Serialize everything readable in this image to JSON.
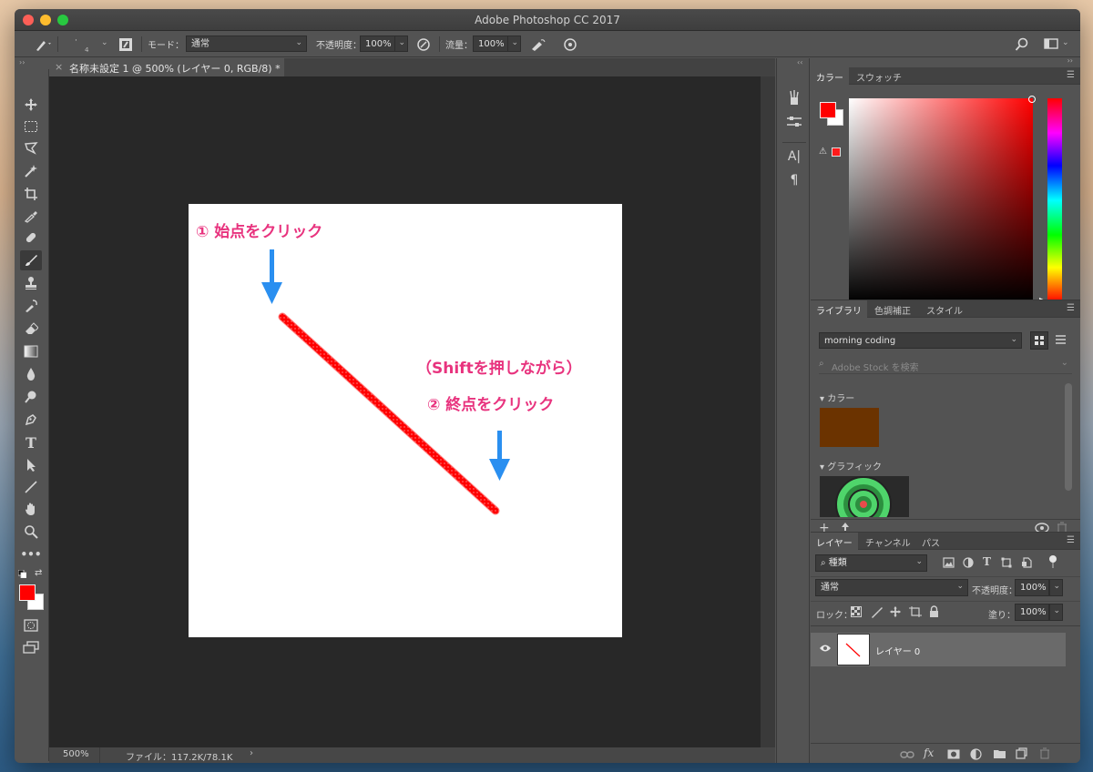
{
  "window": {
    "title": "Adobe Photoshop CC 2017"
  },
  "options_bar": {
    "brush_size": "4",
    "mode_label": "モード：",
    "mode_value": "通常",
    "opacity_label": "不透明度：",
    "opacity_value": "100%",
    "flow_label": "流量：",
    "flow_value": "100%"
  },
  "document": {
    "tab_title": "名称未設定 1 @ 500% (レイヤー 0, RGB/8) *",
    "zoom": "500%",
    "file_info": "ファイル：117.2K/78.1K",
    "annotations": {
      "step1": "① 始点をクリック",
      "shift_note": "（Shiftを押しながら）",
      "step2": "② 終点をクリック"
    }
  },
  "color_panel": {
    "tabs": [
      "カラー",
      "スウォッチ"
    ],
    "foreground": "#ff0000",
    "background": "#ffffff"
  },
  "library_panel": {
    "tabs": [
      "ライブラリ",
      "色調補正",
      "スタイル"
    ],
    "library_name": "morning coding",
    "search_placeholder": "Adobe Stock を検索",
    "section_colors": "カラー",
    "swatch_color": "#6b3300",
    "section_graphics": "グラフィック"
  },
  "layers_panel": {
    "tabs": [
      "レイヤー",
      "チャンネル",
      "パス"
    ],
    "filter_kind": "種類",
    "blend_mode": "通常",
    "opacity_label": "不透明度：",
    "opacity_value": "100%",
    "lock_label": "ロック：",
    "fill_label": "塗り：",
    "fill_value": "100%",
    "layers": [
      {
        "name": "レイヤー 0"
      }
    ]
  },
  "colors": {
    "accent_pink": "#e8337e",
    "arrow_blue": "#2a8ff0",
    "stroke_red": "#ff0000"
  }
}
